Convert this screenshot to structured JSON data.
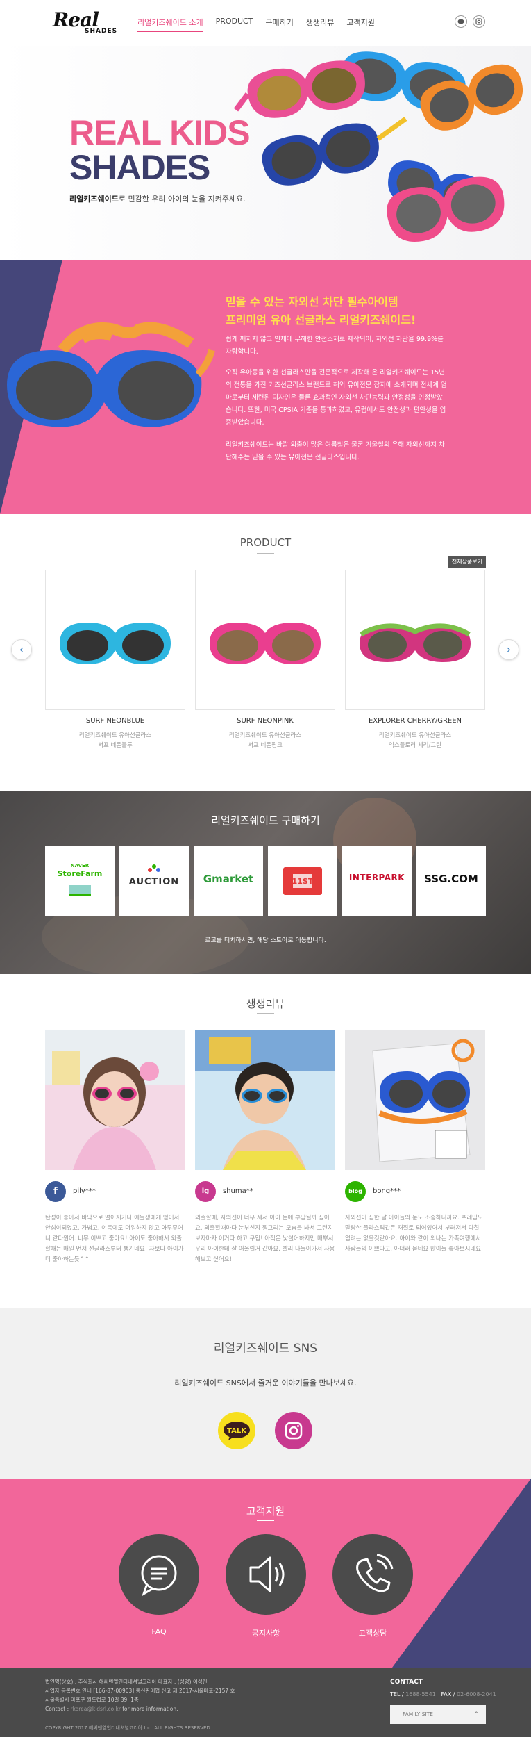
{
  "header": {
    "logo_top": "Real",
    "logo_bottom": "SHADES",
    "nav": [
      "리얼키즈쉐이드 소개",
      "PRODUCT",
      "구매하기",
      "생생리뷰",
      "고객지원"
    ]
  },
  "hero": {
    "title_line1": "REAL KIDS",
    "title_line2": "SHADES",
    "subtitle_bold": "리얼키즈쉐이드",
    "subtitle_rest": "로 민감한 우리 아이의 눈을 지켜주세요."
  },
  "intro": {
    "heading_line1": "믿을 수 있는 자외선 차단 필수아이템",
    "heading_line2": "프리미엄 유아 선글라스 리얼키즈쉐이드!",
    "para1": "쉽게 깨지지 않고 인체에 무해한 안전소재로 제작되어, 자외선 차단율 99.9%를 자랑합니다.",
    "para2": "오직 유아동을 위한 선글라스만을 전문적으로 제작해 온 리얼키즈쉐이드는 15년의 전통을 가진 키즈선글라스 브랜드로 해외 유아전문 잡지에 소개되며 전세계 엄마로부터 세련된 디자인은 물론 효과적인 자외선 차단능력과 안정성을 인정받았습니다. 또한, 미국 CPSIA 기준을 통과하였고, 유럽에서도 안전성과 편안성을 입증받았습니다.",
    "para3": "리얼키즈쉐이드는 바깥 외출이 많은 여름철은 물론 겨울철의 유해 자외선까지 차단해주는 믿을 수 있는 유아전문 선글라스입니다."
  },
  "products": {
    "title": "PRODUCT",
    "all_button": "전체상품보기",
    "prev_arrow": "‹",
    "next_arrow": "›",
    "items": [
      {
        "name": "SURF NEONBLUE",
        "desc1": "리얼키즈쉐이드 유아선글라스",
        "desc2": "서프 네온블루"
      },
      {
        "name": "SURF NEONPINK",
        "desc1": "리얼키즈쉐이드 유아선글라스",
        "desc2": "서프 네온핑크"
      },
      {
        "name": "EXPLORER CHERRY/GREEN",
        "desc1": "리얼키즈쉐이드 유아선글라스",
        "desc2": "익스플로러 체리/그린"
      }
    ]
  },
  "buy": {
    "title": "리얼키즈쉐이드 구매하기",
    "shops": [
      "StoreFarm",
      "AUCTION",
      "Gmarket",
      "11ST",
      "INTERPARK",
      "SSG.COM"
    ],
    "naver_label": "NAVER",
    "note": "로고를 터치하시면, 해당 스토어로 이동합니다."
  },
  "reviews": {
    "title": "생생리뷰",
    "items": [
      {
        "user": "pily***",
        "badge": "f",
        "text": "탄성이 좋아서 바닥으로 떨어지거나 애들쟁에게 얻어서 안심이되었고. 가볍고, 여름에도 더워하지 않고 아무무어니 같다원어. 너무 이쁘고 좋아요! 아이도 좋아해서 외출할때는 매일 먼저 선글라스부터 챙기네요! 자보다 아이가 더 좋아하는듯^^"
      },
      {
        "user": "shuma**",
        "badge": "ig",
        "text": "외출할때, 자외선이 너무 세서 아이 눈에 부담될까 싶어요. 외출할때마다 눈부신지 찡그리는 모습을 봐서 그런지 보자마자 이거다 하고 구입! 아직은 낯설어하지만 매뿌서 우리 아이한테 잘 어울릴거 같아요. 빨리 나들이가서 사용해보고 싶어요!"
      },
      {
        "user": "bong***",
        "badge": "blog",
        "text": "자외선이 심한 날 아이들의 눈도 소중하니까요. 프레임도 말랑한 플라스틱같은 재질로 되어있어서 부러져서 다칠 염려는 없을것같아요. 아이와 같이 외나는 가족여행에서 사람들의 이쁘다고, 아더러 묻네요 많이들 좋아보시네요."
      }
    ]
  },
  "sns": {
    "title": "리얼키즈쉐이드 SNS",
    "subtitle": "리얼키즈쉐이드 SNS에서 즐거운 이야기들을 만나보세요.",
    "talk_label": "TALK"
  },
  "support": {
    "title": "고객지원",
    "items": [
      "FAQ",
      "공지사항",
      "고객상담"
    ]
  },
  "footer": {
    "line1": "법인명(상호) : 주식회사 해써덴엘인터내셔널코리아 대표자 : (성명) 이성진",
    "line2": "사업자 등록번호 안내 [166-87-00903] 통신판매업 신고 제 2017-서울마포-2157 호",
    "line3": "서울특별시 마포구 월드컵로 10길 39, 1층",
    "contact_prefix": "Contact :",
    "contact_email": "rkorea@kidsrl.co.kr",
    "contact_suffix": "for more information.",
    "copyright": "COPYRIGHT 2017 해써덴엘인터내셔널코리아 Inc. ALL RIGHTS RESERVED.",
    "contact_title": "CONTACT",
    "tel_label": "TEL /",
    "tel_value": "1688-5541",
    "fax_label": "FAX /",
    "fax_value": "02-6008-2041",
    "family_site": "FAMILY SITE",
    "family_chev": "^"
  }
}
